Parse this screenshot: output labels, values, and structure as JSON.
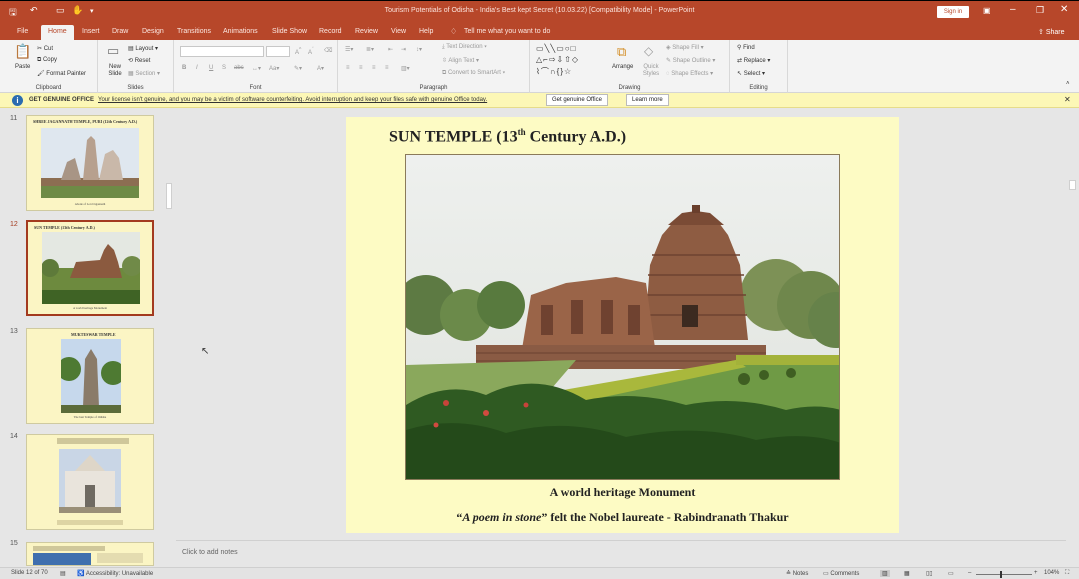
{
  "window": {
    "title": "Tourism Potentials of Odisha - India's Best kept Secret (10.03.22) [Compatibility Mode] - PowerPoint",
    "sign_in": "Sign in",
    "share": "Share"
  },
  "tabs": [
    "File",
    "Home",
    "Insert",
    "Draw",
    "Design",
    "Transitions",
    "Animations",
    "Slide Show",
    "Record",
    "Review",
    "View",
    "Help"
  ],
  "active_tab": "Home",
  "tell_me": "Tell me what you want to do",
  "ribbon": {
    "clipboard": {
      "label": "Clipboard",
      "paste": "Paste",
      "cut": "Cut",
      "copy": "Copy",
      "format_painter": "Format Painter"
    },
    "slides": {
      "label": "Slides",
      "new_slide": "New Slide",
      "layout": "Layout",
      "reset": "Reset",
      "section": "Section"
    },
    "font": {
      "label": "Font"
    },
    "paragraph": {
      "label": "Paragraph",
      "text_direction": "Text Direction",
      "align_text": "Align Text",
      "convert_smartart": "Convert to SmartArt"
    },
    "drawing": {
      "label": "Drawing",
      "arrange": "Arrange",
      "quick_styles": "Quick Styles",
      "shape_fill": "Shape Fill",
      "shape_outline": "Shape Outline",
      "shape_effects": "Shape Effects"
    },
    "editing": {
      "label": "Editing",
      "find": "Find",
      "replace": "Replace",
      "select": "Select"
    }
  },
  "message_bar": {
    "title": "GET GENUINE OFFICE",
    "text": "Your license isn't genuine, and you may be a victim of software counterfeiting. Avoid interruption and keep your files safe with genuine Office today.",
    "btn_genuine": "Get genuine Office",
    "btn_learn": "Learn more"
  },
  "thumbnails": [
    {
      "num": "11",
      "title": "SHREE JAGANNATH TEMPLE, PURI (12th Century A.D.)",
      "caption": "Abode of Lord Jagannath"
    },
    {
      "num": "12",
      "title": "SUN TEMPLE (13th Century A.D.)",
      "caption": "A world heritage Monument"
    },
    {
      "num": "13",
      "title": "MUKTESWAR TEMPLE",
      "caption": "The best Temple of Odisha"
    },
    {
      "num": "14",
      "title": "",
      "caption": ""
    },
    {
      "num": "15",
      "title": "",
      "caption": ""
    }
  ],
  "slide": {
    "title_pre": "SUN TEMPLE (13",
    "title_sup": "th",
    "title_post": " Century A.D.)",
    "caption1": "A world heritage Monument",
    "caption2_open": "“",
    "caption2_italic": "A poem in stone",
    "caption2_rest": "” felt the Nobel laureate - Rabindranath Thakur"
  },
  "notes_placeholder": "Click to add notes",
  "status": {
    "slide": "Slide 12 of 70",
    "accessibility": "Accessibility: Unavailable",
    "notes": "Notes",
    "comments": "Comments",
    "zoom": "104%"
  },
  "colors": {
    "accent": "#b7472a",
    "slide_bg": "#fdfbc4",
    "message_bar": "#fcf7b6"
  }
}
